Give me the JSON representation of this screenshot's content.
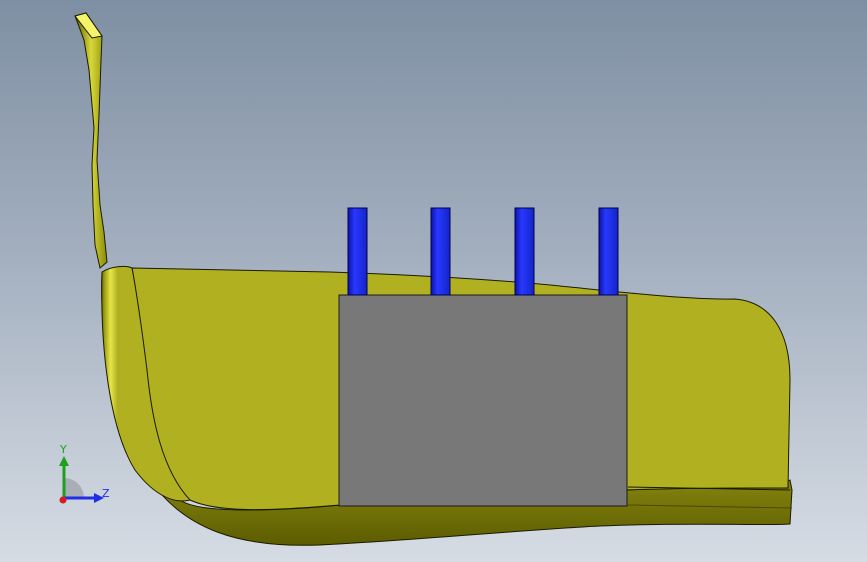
{
  "viewport": {
    "background_top": "#7f8fa3",
    "background_bottom": "#d6dce4"
  },
  "model": {
    "body_color": "#b1b020",
    "body_shade": "#808000",
    "block_color": "#787878",
    "pin_color": "#1f2fe6",
    "pin_count": 4
  },
  "triad": {
    "y_label": "Y",
    "z_label": "Z",
    "y_color": "#1ea01e",
    "z_color": "#1f2fe6",
    "x_color": "#d21e1e"
  }
}
